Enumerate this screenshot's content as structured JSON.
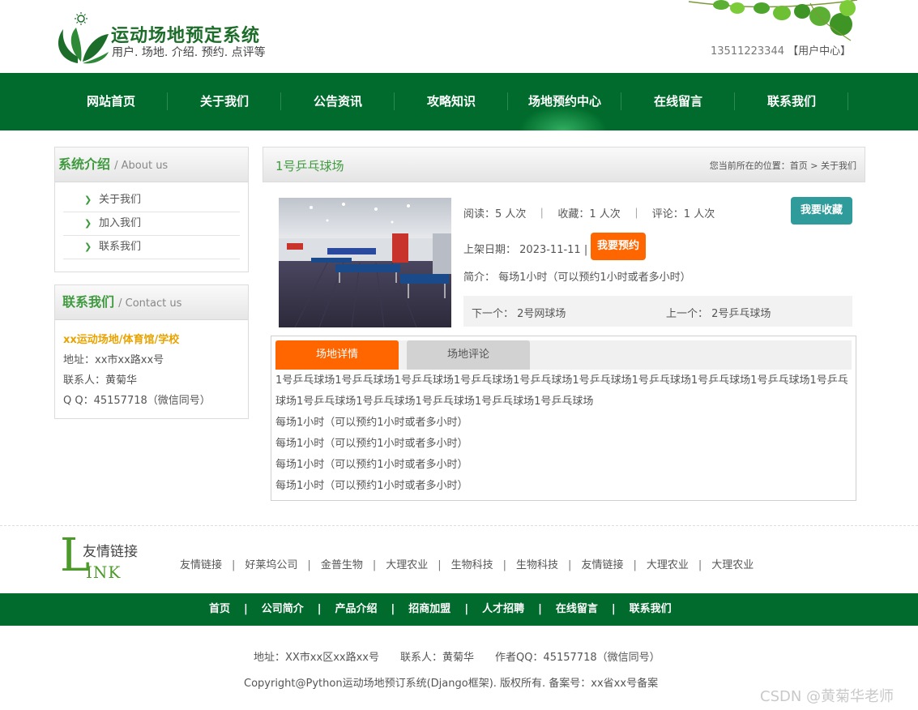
{
  "header": {
    "title": "运动场地预定系统",
    "subtitle": "用户. 场地. 介绍. 预约. 点评等",
    "phone": "13511223344",
    "user_center": "【用户中心】"
  },
  "nav": {
    "items": [
      {
        "label": "网站首页"
      },
      {
        "label": "关于我们"
      },
      {
        "label": "公告资讯"
      },
      {
        "label": "攻略知识"
      },
      {
        "label": "场地预约中心"
      },
      {
        "label": "在线留言"
      },
      {
        "label": "联系我们"
      }
    ]
  },
  "sidebar": {
    "about": {
      "title_cn": "系统介绍",
      "title_en": "/ About us",
      "items": [
        {
          "label": "关于我们"
        },
        {
          "label": "加入我们"
        },
        {
          "label": "联系我们"
        }
      ]
    },
    "contact": {
      "title_cn": "联系我们",
      "title_en": "/ Contact us",
      "org": "xx运动场地/体育馆/学校",
      "address": "地址：xx市xx路xx号",
      "person": "联系人：黄菊华",
      "qq": "Q Q：45157718（微信同号）"
    }
  },
  "main": {
    "title": "1号乒乓球场",
    "breadcrumb": "您当前所在的位置：首页 > 关于我们",
    "stats": "阅读：5 人次　｜　收藏：1 人次　｜　评论：1 人次",
    "fav_button": "我要收藏",
    "date_label": "上架日期：",
    "date_value": "2023-11-11",
    "date_sep": "|",
    "book_button": "我要预约",
    "intro": "简介：  每场1小时（可以预约1小时或者多小时）",
    "next": "下一个：  2号网球场",
    "prev": "上一个：  2号乒乓球场",
    "tabs": [
      {
        "label": "场地详情"
      },
      {
        "label": "场地评论"
      }
    ],
    "detail": {
      "paragraph": "1号乒乓球场1号乒乓球场1号乒乓球场1号乒乓球场1号乒乓球场1号乒乓球场1号乒乓球场1号乒乓球场1号乒乓球场1号乒乓球场1号乒乓球场1号乒乓球场1号乒乓球场1号乒乓球场1号乒乓球场",
      "lines": [
        "每场1小时（可以预约1小时或者多小时）",
        "每场1小时（可以预约1小时或者多小时）",
        "每场1小时（可以预约1小时或者多小时）",
        "每场1小时（可以预约1小时或者多小时）"
      ]
    }
  },
  "friend_links": {
    "title_cn": "友情链接",
    "title_big": "L",
    "title_ink": "INK",
    "items": [
      "友情链接",
      "好莱坞公司",
      "金普生物",
      "大理农业",
      "生物科技",
      "生物科技",
      "友情链接",
      "大理农业",
      "大理农业"
    ]
  },
  "footer": {
    "nav": [
      "首页",
      "公司简介",
      "产品介绍",
      "招商加盟",
      "人才招聘",
      "在线留言",
      "联系我们"
    ],
    "address": "地址：XX市xx区xx路xx号　　联系人：黄菊华　　作者QQ：45157718（微信同号）",
    "copyright": "Copyright@Python运动场地预订系统(Django框架). 版权所有. 备案号：xx省xx号备案"
  },
  "watermark": "CSDN @黄菊华老师",
  "colors": {
    "brand_green": "#006b2c",
    "accent_orange": "#ff6600",
    "teal_button": "#2f9b9b"
  }
}
